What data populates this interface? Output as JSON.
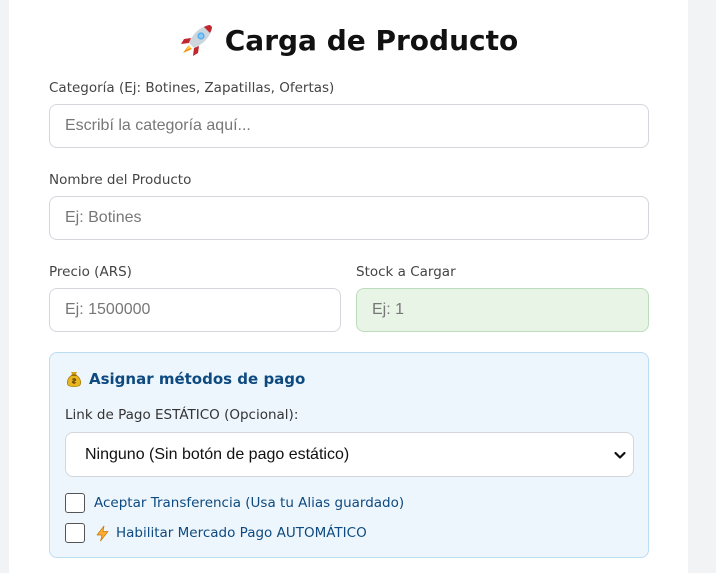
{
  "header": {
    "title": "Carga de Producto",
    "icon": "rocket-icon"
  },
  "form": {
    "category": {
      "label": "Categoría (Ej: Botines, Zapatillas, Ofertas)",
      "placeholder": "Escribí la categoría aquí...",
      "value": ""
    },
    "name": {
      "label": "Nombre del Producto",
      "placeholder": "Ej: Botines",
      "value": ""
    },
    "price": {
      "label": "Precio (ARS)",
      "placeholder": "Ej: 1500000",
      "value": ""
    },
    "stock": {
      "label": "Stock a Cargar",
      "placeholder": "Ej: 1",
      "value": ""
    }
  },
  "payment": {
    "title": "Asignar métodos de pago",
    "title_icon": "money-bag-icon",
    "static_link_label": "Link de Pago ESTÁTICO (Opcional):",
    "static_link_selected": "Ninguno (Sin botón de pago estático)",
    "transfer": {
      "label": "Aceptar Transferencia (Usa tu Alias guardado)",
      "checked": false
    },
    "mercadopago": {
      "label": "Habilitar Mercado Pago AUTOMÁTICO",
      "icon": "lightning-icon",
      "checked": false
    }
  },
  "colors": {
    "accent": "#0d4a80",
    "panel_bg": "#eef6fd",
    "stock_bg": "#e8f5e6"
  }
}
